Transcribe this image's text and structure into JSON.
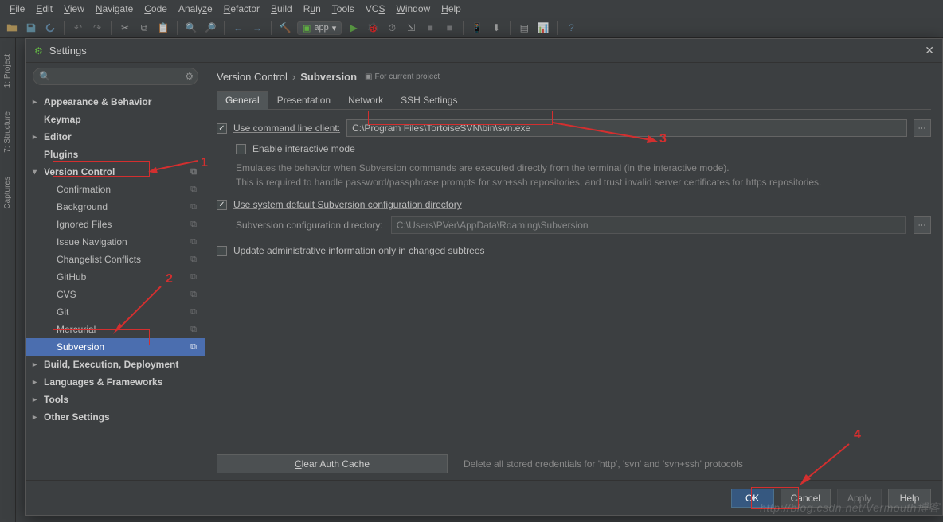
{
  "menubar": [
    "File",
    "Edit",
    "View",
    "Navigate",
    "Code",
    "Analyze",
    "Refactor",
    "Build",
    "Run",
    "Tools",
    "VCS",
    "Window",
    "Help"
  ],
  "run_config": "app",
  "dialog": {
    "title": "Settings",
    "breadcrumb": {
      "root": "Version Control",
      "leaf": "Subversion",
      "for_project": "For current project"
    },
    "tabs": [
      "General",
      "Presentation",
      "Network",
      "SSH Settings"
    ],
    "active_tab": 0,
    "sidebar": [
      {
        "label": "Appearance & Behavior",
        "level": 1,
        "arrow": true
      },
      {
        "label": "Keymap",
        "level": 1
      },
      {
        "label": "Editor",
        "level": 1,
        "arrow": true
      },
      {
        "label": "Plugins",
        "level": 1
      },
      {
        "label": "Version Control",
        "level": 1,
        "arrow": true,
        "expanded": true,
        "copy": true
      },
      {
        "label": "Confirmation",
        "level": 2,
        "copy": true
      },
      {
        "label": "Background",
        "level": 2,
        "copy": true
      },
      {
        "label": "Ignored Files",
        "level": 2,
        "copy": true
      },
      {
        "label": "Issue Navigation",
        "level": 2,
        "copy": true
      },
      {
        "label": "Changelist Conflicts",
        "level": 2,
        "copy": true
      },
      {
        "label": "GitHub",
        "level": 2,
        "copy": true
      },
      {
        "label": "CVS",
        "level": 2,
        "copy": true
      },
      {
        "label": "Git",
        "level": 2,
        "copy": true
      },
      {
        "label": "Mercurial",
        "level": 2,
        "copy": true
      },
      {
        "label": "Subversion",
        "level": 2,
        "selected": true,
        "copy": true
      },
      {
        "label": "Build, Execution, Deployment",
        "level": 1,
        "arrow": true
      },
      {
        "label": "Languages & Frameworks",
        "level": 1,
        "arrow": true
      },
      {
        "label": "Tools",
        "level": 1,
        "arrow": true
      },
      {
        "label": "Other Settings",
        "level": 1,
        "arrow": true
      }
    ],
    "form": {
      "use_cli_label": "Use command line client:",
      "cli_path": "C:\\Program Files\\TortoiseSVN\\bin\\svn.exe",
      "interactive_label": "Enable interactive mode",
      "help1": "Emulates the behavior when Subversion commands are executed directly from the terminal (in the interactive mode).",
      "help2": "This is required to handle password/passphrase prompts for svn+ssh repositories, and trust invalid server certificates for https repositories.",
      "use_default_dir_label": "Use system default Subversion configuration directory",
      "config_dir_label": "Subversion configuration directory:",
      "config_dir_value": "C:\\Users\\PVer\\AppData\\Roaming\\Subversion",
      "update_admin_label": "Update administrative information only in changed subtrees",
      "clear_btn": "Clear Auth Cache",
      "clear_desc": "Delete all stored credentials for 'http', 'svn' and 'svn+ssh' protocols"
    },
    "buttons": {
      "ok": "OK",
      "cancel": "Cancel",
      "apply": "Apply",
      "help": "Help"
    }
  },
  "rail": [
    "1: Project",
    "7: Structure",
    "Captures"
  ],
  "annotations": {
    "n1": "1",
    "n2": "2",
    "n3": "3",
    "n4": "4"
  },
  "watermark": "http://blog.csdn.net/Vermouth博客"
}
